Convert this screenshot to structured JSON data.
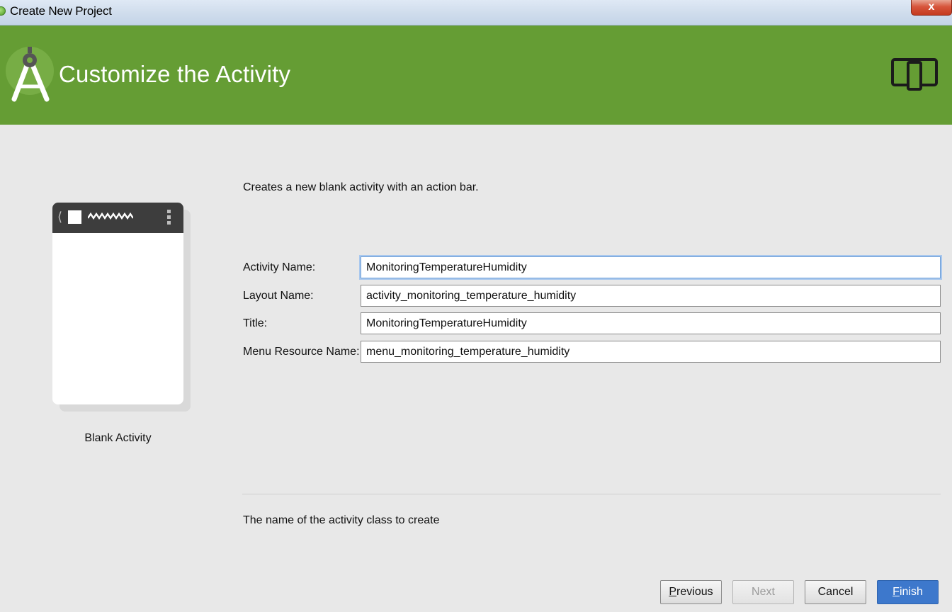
{
  "window": {
    "title": "Create New Project",
    "close_label": "x"
  },
  "banner": {
    "heading": "Customize the Activity",
    "color": "#659d34"
  },
  "preview": {
    "template_name": "Blank Activity"
  },
  "form": {
    "description": "Creates a new blank activity with an action bar.",
    "fields": [
      {
        "label": "Activity Name:",
        "value": "MonitoringTemperatureHumidity"
      },
      {
        "label": "Layout Name:",
        "value": "activity_monitoring_temperature_humidity"
      },
      {
        "label": "Title:",
        "value": "MonitoringTemperatureHumidity"
      },
      {
        "label": "Menu Resource Name:",
        "value": "menu_monitoring_temperature_humidity"
      }
    ],
    "hint": "The name of the activity class to create"
  },
  "buttons": {
    "previous": {
      "mnemonic": "P",
      "rest": "revious"
    },
    "next": "Next",
    "cancel": "Cancel",
    "finish": {
      "mnemonic": "F",
      "rest": "inish"
    }
  },
  "colors": {
    "accent": "#3d78cc",
    "banner": "#659d34"
  }
}
